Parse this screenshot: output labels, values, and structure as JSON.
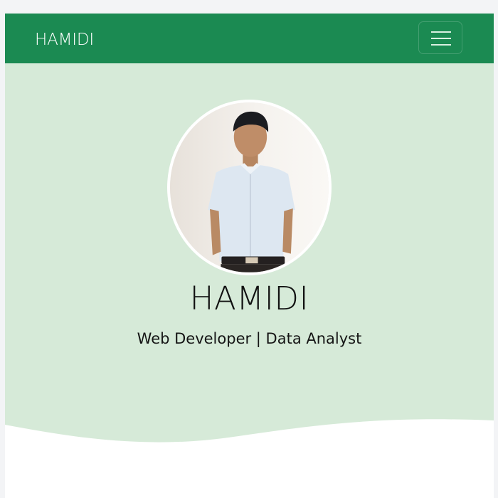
{
  "navbar": {
    "brand": "HAMIDI",
    "color": "#1b8a52",
    "toggle_icon": "hamburger-menu-icon"
  },
  "hero": {
    "background_color": "#d6ead8",
    "profile_photo": "profile-photo",
    "name": "HAMIDI",
    "tagline": "Web Developer | Data Analyst"
  }
}
